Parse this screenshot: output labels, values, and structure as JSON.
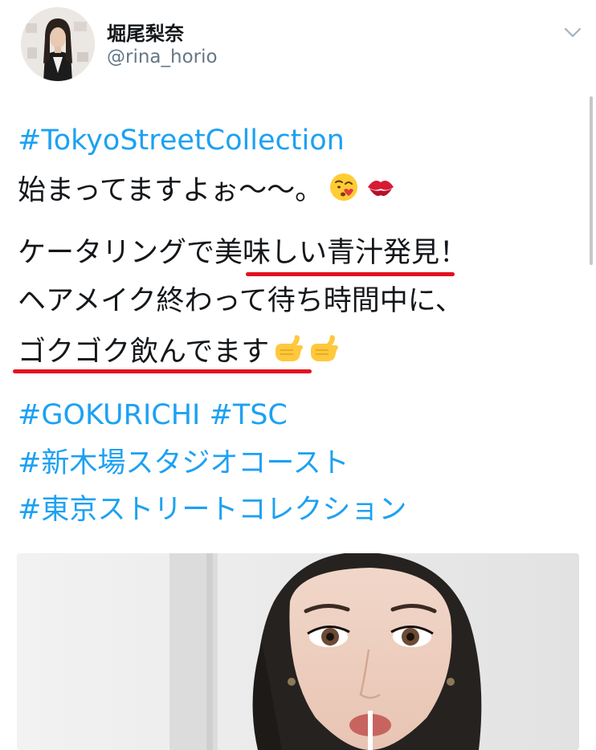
{
  "author": {
    "display_name": "堀尾梨奈",
    "handle": "@rina_horio"
  },
  "tweet": {
    "hashtag_tsc": "#TokyoStreetCollection",
    "line_started": "始まってますよぉ〜〜。",
    "line_catering": "ケータリングで美味しい青汁発見！",
    "line_hairmake": "ヘアメイク終わって待ち時間中に、",
    "line_drinking": "ゴクゴク飲んでます",
    "hashtag_gokurichi": "#GOKURICHI",
    "hashtag_tsc_short": "#TSC",
    "hashtag_venue": "#新木場スタジオコースト",
    "hashtag_collection_jp": "#東京ストリートコレクション"
  },
  "icons": {
    "menu": "chevron-down-icon",
    "emoji_1": "kissing-face-emoji",
    "emoji_2": "kiss-mark-emoji",
    "emoji_3": "call-me-hand-emoji"
  },
  "colors": {
    "link": "#1da1f2",
    "handle": "#657786",
    "underline": "#e3111e"
  }
}
